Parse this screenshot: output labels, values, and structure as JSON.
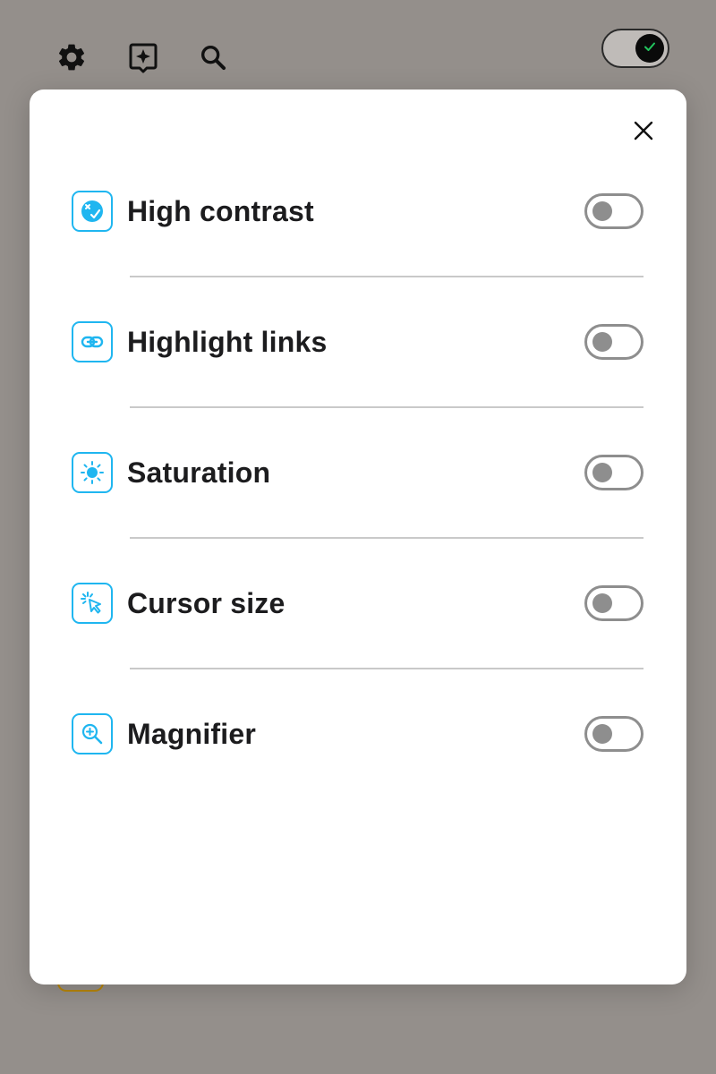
{
  "topbar": {
    "icons": [
      "gear-icon",
      "sparkle-bookmark-icon",
      "search-icon"
    ],
    "theme_toggle": {
      "state": "on",
      "icon": "check-icon"
    }
  },
  "panel": {
    "close_icon": "close-icon",
    "rows": [
      {
        "label": "High contrast",
        "icon": "contrast-icon",
        "enabled": false
      },
      {
        "label": "Highlight links",
        "icon": "link-icon",
        "enabled": false
      },
      {
        "label": "Saturation",
        "icon": "sun-icon",
        "enabled": false
      },
      {
        "label": "Cursor size",
        "icon": "cursor-click-icon",
        "enabled": false
      },
      {
        "label": "Magnifier",
        "icon": "magnifier-icon",
        "enabled": false
      }
    ]
  },
  "colors": {
    "overlay": "#948f8b",
    "panel_bg": "#ffffff",
    "accent": "#1fb6f0",
    "label_text": "#1c1c1e",
    "switch_off": "#8e8e8e",
    "divider": "#c9c9c9",
    "check": "#22c55e"
  }
}
